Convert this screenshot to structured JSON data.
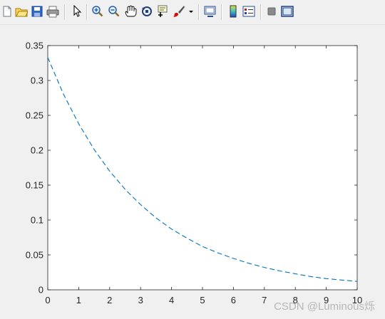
{
  "toolbar": {
    "tools": [
      "new-figure-icon",
      "open-file-icon",
      "save-figure-icon",
      "print-figure-icon",
      "edit-plot-icon",
      "zoom-in-icon",
      "zoom-out-icon",
      "pan-hand-icon",
      "rotate-3d-icon",
      "data-cursor-icon",
      "brush-icon",
      "dropdown-arrow-icon",
      "link-plot-icon",
      "colorbar-icon",
      "legend-icon",
      "hide-plot-tools-icon",
      "show-plot-tools-icon"
    ]
  },
  "colors": {
    "line": "#0072bd",
    "axis": "#262626",
    "background": "#f0f0f0"
  },
  "chart_data": {
    "type": "line",
    "line_style": "dashed",
    "grid": false,
    "xlim": [
      0,
      10
    ],
    "ylim": [
      0,
      0.35
    ],
    "x_ticks": [
      "0",
      "1",
      "2",
      "3",
      "4",
      "5",
      "6",
      "7",
      "8",
      "9",
      "10"
    ],
    "y_ticks": [
      "0",
      "0.05",
      "0.1",
      "0.15",
      "0.2",
      "0.25",
      "0.3",
      "0.35"
    ],
    "series": [
      {
        "x": [
          0,
          0.5,
          1,
          1.5,
          2,
          2.5,
          3,
          3.5,
          4,
          4.5,
          5,
          5.5,
          6,
          6.5,
          7,
          7.5,
          8,
          8.5,
          9,
          9.5,
          10
        ],
        "values": [
          0.333,
          0.281,
          0.238,
          0.201,
          0.17,
          0.144,
          0.122,
          0.103,
          0.087,
          0.074,
          0.062,
          0.053,
          0.045,
          0.038,
          0.032,
          0.027,
          0.023,
          0.019,
          0.016,
          0.014,
          0.012
        ]
      }
    ]
  },
  "watermark": "CSDN @Luminous烁"
}
